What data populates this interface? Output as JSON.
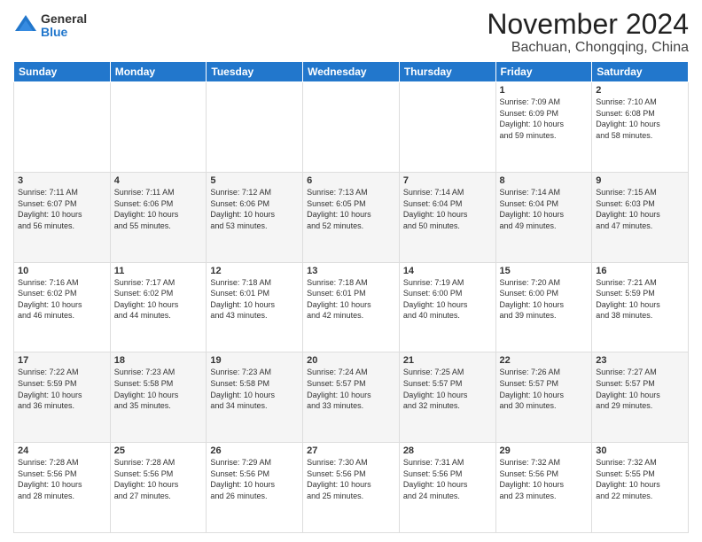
{
  "logo": {
    "general": "General",
    "blue": "Blue"
  },
  "title": "November 2024",
  "subtitle": "Bachuan, Chongqing, China",
  "days_header": [
    "Sunday",
    "Monday",
    "Tuesday",
    "Wednesday",
    "Thursday",
    "Friday",
    "Saturday"
  ],
  "weeks": [
    [
      {
        "day": "",
        "info": ""
      },
      {
        "day": "",
        "info": ""
      },
      {
        "day": "",
        "info": ""
      },
      {
        "day": "",
        "info": ""
      },
      {
        "day": "",
        "info": ""
      },
      {
        "day": "1",
        "info": "Sunrise: 7:09 AM\nSunset: 6:09 PM\nDaylight: 10 hours\nand 59 minutes."
      },
      {
        "day": "2",
        "info": "Sunrise: 7:10 AM\nSunset: 6:08 PM\nDaylight: 10 hours\nand 58 minutes."
      }
    ],
    [
      {
        "day": "3",
        "info": "Sunrise: 7:11 AM\nSunset: 6:07 PM\nDaylight: 10 hours\nand 56 minutes."
      },
      {
        "day": "4",
        "info": "Sunrise: 7:11 AM\nSunset: 6:06 PM\nDaylight: 10 hours\nand 55 minutes."
      },
      {
        "day": "5",
        "info": "Sunrise: 7:12 AM\nSunset: 6:06 PM\nDaylight: 10 hours\nand 53 minutes."
      },
      {
        "day": "6",
        "info": "Sunrise: 7:13 AM\nSunset: 6:05 PM\nDaylight: 10 hours\nand 52 minutes."
      },
      {
        "day": "7",
        "info": "Sunrise: 7:14 AM\nSunset: 6:04 PM\nDaylight: 10 hours\nand 50 minutes."
      },
      {
        "day": "8",
        "info": "Sunrise: 7:14 AM\nSunset: 6:04 PM\nDaylight: 10 hours\nand 49 minutes."
      },
      {
        "day": "9",
        "info": "Sunrise: 7:15 AM\nSunset: 6:03 PM\nDaylight: 10 hours\nand 47 minutes."
      }
    ],
    [
      {
        "day": "10",
        "info": "Sunrise: 7:16 AM\nSunset: 6:02 PM\nDaylight: 10 hours\nand 46 minutes."
      },
      {
        "day": "11",
        "info": "Sunrise: 7:17 AM\nSunset: 6:02 PM\nDaylight: 10 hours\nand 44 minutes."
      },
      {
        "day": "12",
        "info": "Sunrise: 7:18 AM\nSunset: 6:01 PM\nDaylight: 10 hours\nand 43 minutes."
      },
      {
        "day": "13",
        "info": "Sunrise: 7:18 AM\nSunset: 6:01 PM\nDaylight: 10 hours\nand 42 minutes."
      },
      {
        "day": "14",
        "info": "Sunrise: 7:19 AM\nSunset: 6:00 PM\nDaylight: 10 hours\nand 40 minutes."
      },
      {
        "day": "15",
        "info": "Sunrise: 7:20 AM\nSunset: 6:00 PM\nDaylight: 10 hours\nand 39 minutes."
      },
      {
        "day": "16",
        "info": "Sunrise: 7:21 AM\nSunset: 5:59 PM\nDaylight: 10 hours\nand 38 minutes."
      }
    ],
    [
      {
        "day": "17",
        "info": "Sunrise: 7:22 AM\nSunset: 5:59 PM\nDaylight: 10 hours\nand 36 minutes."
      },
      {
        "day": "18",
        "info": "Sunrise: 7:23 AM\nSunset: 5:58 PM\nDaylight: 10 hours\nand 35 minutes."
      },
      {
        "day": "19",
        "info": "Sunrise: 7:23 AM\nSunset: 5:58 PM\nDaylight: 10 hours\nand 34 minutes."
      },
      {
        "day": "20",
        "info": "Sunrise: 7:24 AM\nSunset: 5:57 PM\nDaylight: 10 hours\nand 33 minutes."
      },
      {
        "day": "21",
        "info": "Sunrise: 7:25 AM\nSunset: 5:57 PM\nDaylight: 10 hours\nand 32 minutes."
      },
      {
        "day": "22",
        "info": "Sunrise: 7:26 AM\nSunset: 5:57 PM\nDaylight: 10 hours\nand 30 minutes."
      },
      {
        "day": "23",
        "info": "Sunrise: 7:27 AM\nSunset: 5:57 PM\nDaylight: 10 hours\nand 29 minutes."
      }
    ],
    [
      {
        "day": "24",
        "info": "Sunrise: 7:28 AM\nSunset: 5:56 PM\nDaylight: 10 hours\nand 28 minutes."
      },
      {
        "day": "25",
        "info": "Sunrise: 7:28 AM\nSunset: 5:56 PM\nDaylight: 10 hours\nand 27 minutes."
      },
      {
        "day": "26",
        "info": "Sunrise: 7:29 AM\nSunset: 5:56 PM\nDaylight: 10 hours\nand 26 minutes."
      },
      {
        "day": "27",
        "info": "Sunrise: 7:30 AM\nSunset: 5:56 PM\nDaylight: 10 hours\nand 25 minutes."
      },
      {
        "day": "28",
        "info": "Sunrise: 7:31 AM\nSunset: 5:56 PM\nDaylight: 10 hours\nand 24 minutes."
      },
      {
        "day": "29",
        "info": "Sunrise: 7:32 AM\nSunset: 5:56 PM\nDaylight: 10 hours\nand 23 minutes."
      },
      {
        "day": "30",
        "info": "Sunrise: 7:32 AM\nSunset: 5:55 PM\nDaylight: 10 hours\nand 22 minutes."
      }
    ]
  ]
}
